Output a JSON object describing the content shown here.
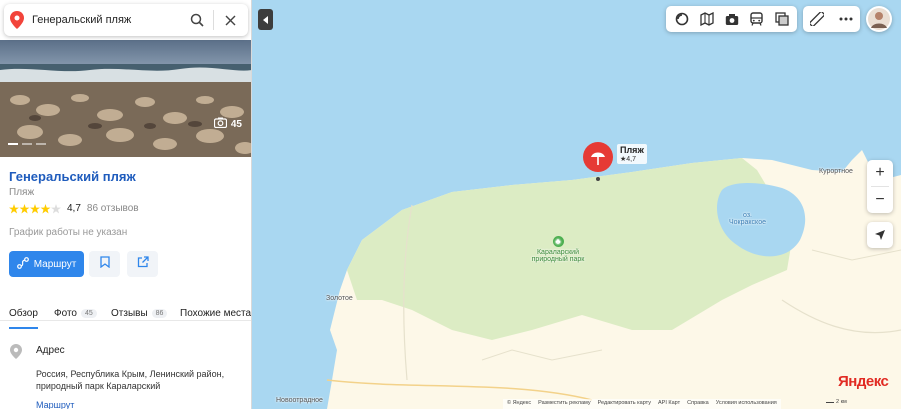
{
  "search": {
    "query": "Генеральский пляж"
  },
  "photo": {
    "count": "45"
  },
  "place": {
    "title": "Генеральский пляж",
    "category": "Пляж",
    "rating": "4,7",
    "stars": 4.7,
    "reviews": "86 отзывов",
    "hours": "График работы не указан",
    "route_label": "Маршрут"
  },
  "tabs": [
    {
      "label": "Обзор",
      "badge": ""
    },
    {
      "label": "Фото",
      "badge": "45"
    },
    {
      "label": "Отзывы",
      "badge": "86"
    },
    {
      "label": "Похожие места",
      "badge": ""
    }
  ],
  "address": {
    "label": "Адрес",
    "text": "Россия, Республика Крым, Ленинский район, природный парк Караларский",
    "route_link": "Маршрут"
  },
  "map": {
    "marker": {
      "name": "Пляж",
      "rating": "★4,7"
    },
    "labels": {
      "park": "Караларский природный парк",
      "lake_line1": "оз.",
      "lake_line2": "Чокракское",
      "kurortnoe": "Курортное",
      "zolotoe": "Золотое",
      "novootradnoe": "Новоотрадное"
    },
    "logo": "Яндекс",
    "scale": "2 км",
    "footer": [
      "© Яндекс",
      "Разместить рекламу",
      "Редактировать карту",
      "API Карт",
      "Справка",
      "Условия использования"
    ]
  },
  "colors": {
    "accent": "#2f86eb",
    "title": "#1f5cbd",
    "marker": "#e63a35",
    "water": "#a9d7f1",
    "land": "#fdf8e8",
    "park": "#dcecc4"
  }
}
